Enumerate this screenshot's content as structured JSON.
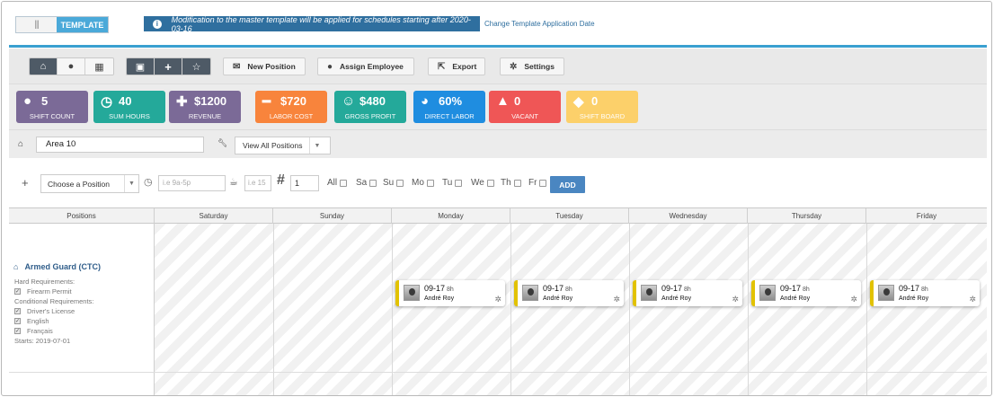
{
  "top": {
    "toggle_knob": "|||",
    "toggle_label": "TEMPLATE",
    "notice": "Modification to the master template will be applied for schedules starting after 2020-03-16",
    "change_link": "Change Template Application Date"
  },
  "toolbar": {
    "new_position": "New Position",
    "assign_employee": "Assign Employee",
    "export": "Export",
    "settings": "Settings"
  },
  "stats": [
    {
      "value": "5",
      "label": "SHIFT COUNT",
      "color": "#7b6a97",
      "icon": "user-icon"
    },
    {
      "value": "40",
      "label": "SUM HOURS",
      "color": "#24a99a",
      "icon": "clock-icon"
    },
    {
      "value": "$1200",
      "label": "REVENUE",
      "color": "#7b6a97",
      "icon": "plus-icon"
    },
    {
      "value": "$720",
      "label": "LABOR COST",
      "color": "#f8843c",
      "icon": "minus-icon"
    },
    {
      "value": "$480",
      "label": "GROSS PROFIT",
      "color": "#24a99a",
      "icon": "smile-icon"
    },
    {
      "value": "60%",
      "label": "DIRECT LABOR",
      "color": "#1f8de0",
      "icon": "pie-icon"
    },
    {
      "value": "0",
      "label": "VACANT",
      "color": "#ef5656",
      "icon": "warning-icon"
    },
    {
      "value": "0",
      "label": "SHIFT BOARD",
      "color": "#fcd06a",
      "icon": "tag-icon"
    }
  ],
  "filter": {
    "area": "Area 10",
    "positions_select": "View All Positions"
  },
  "add_shift": {
    "position_select": "Choose a Position",
    "time_placeholder": "i.e 9a-5p",
    "break_placeholder": "i.e 15",
    "quantity": "1",
    "days": [
      "All",
      "Sa",
      "Su",
      "Mo",
      "Tu",
      "We",
      "Th",
      "Fr"
    ],
    "add_label": "ADD"
  },
  "grid": {
    "positions_header": "Positions",
    "days": [
      "Saturday",
      "Sunday",
      "Monday",
      "Tuesday",
      "Wednesday",
      "Thursday",
      "Friday"
    ]
  },
  "position": {
    "name": "Armed Guard (CTC)",
    "hard_label": "Hard Requirements:",
    "hard": [
      "Firearm Permit"
    ],
    "cond_label": "Conditional Requirements:",
    "cond": [
      "Driver's License",
      "English",
      "Français"
    ],
    "starts": "Starts: 2019-07-01"
  },
  "shifts": [
    {
      "day": "Monday",
      "time": "09-17",
      "hours": "8h",
      "employee": "André Roy"
    },
    {
      "day": "Tuesday",
      "time": "09-17",
      "hours": "8h",
      "employee": "André Roy"
    },
    {
      "day": "Wednesday",
      "time": "09-17",
      "hours": "8h",
      "employee": "André Roy"
    },
    {
      "day": "Thursday",
      "time": "09-17",
      "hours": "8h",
      "employee": "André Roy"
    },
    {
      "day": "Friday",
      "time": "09-17",
      "hours": "8h",
      "employee": "André Roy"
    }
  ]
}
